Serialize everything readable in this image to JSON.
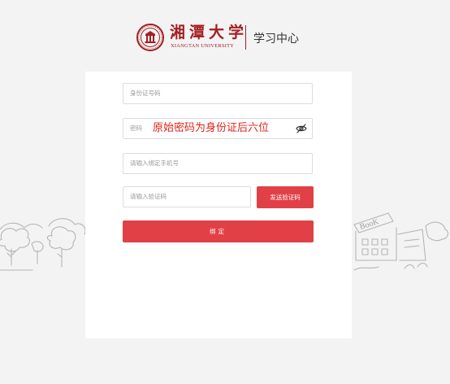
{
  "header": {
    "logo_cn": "湘潭大学",
    "logo_en": "XIANGTAN UNIVERSITY",
    "title": "学习中心"
  },
  "form": {
    "id_placeholder": "身份证号码",
    "password_placeholder": "密码",
    "password_hint": "原始密码为身份证后六位",
    "phone_placeholder": "请输入绑定手机号",
    "code_placeholder": "请输入验证码",
    "send_code_label": "发送验证码",
    "bind_label": "绑定"
  },
  "decorations": {
    "book_sign_text": "BooK"
  },
  "colors": {
    "brand": "#a51e22",
    "accent": "#e24047",
    "hint": "#e2231a",
    "background": "#f3f3f3"
  },
  "icons": {
    "password_toggle": "eye-slash-icon",
    "logo": "university-seal-icon"
  }
}
